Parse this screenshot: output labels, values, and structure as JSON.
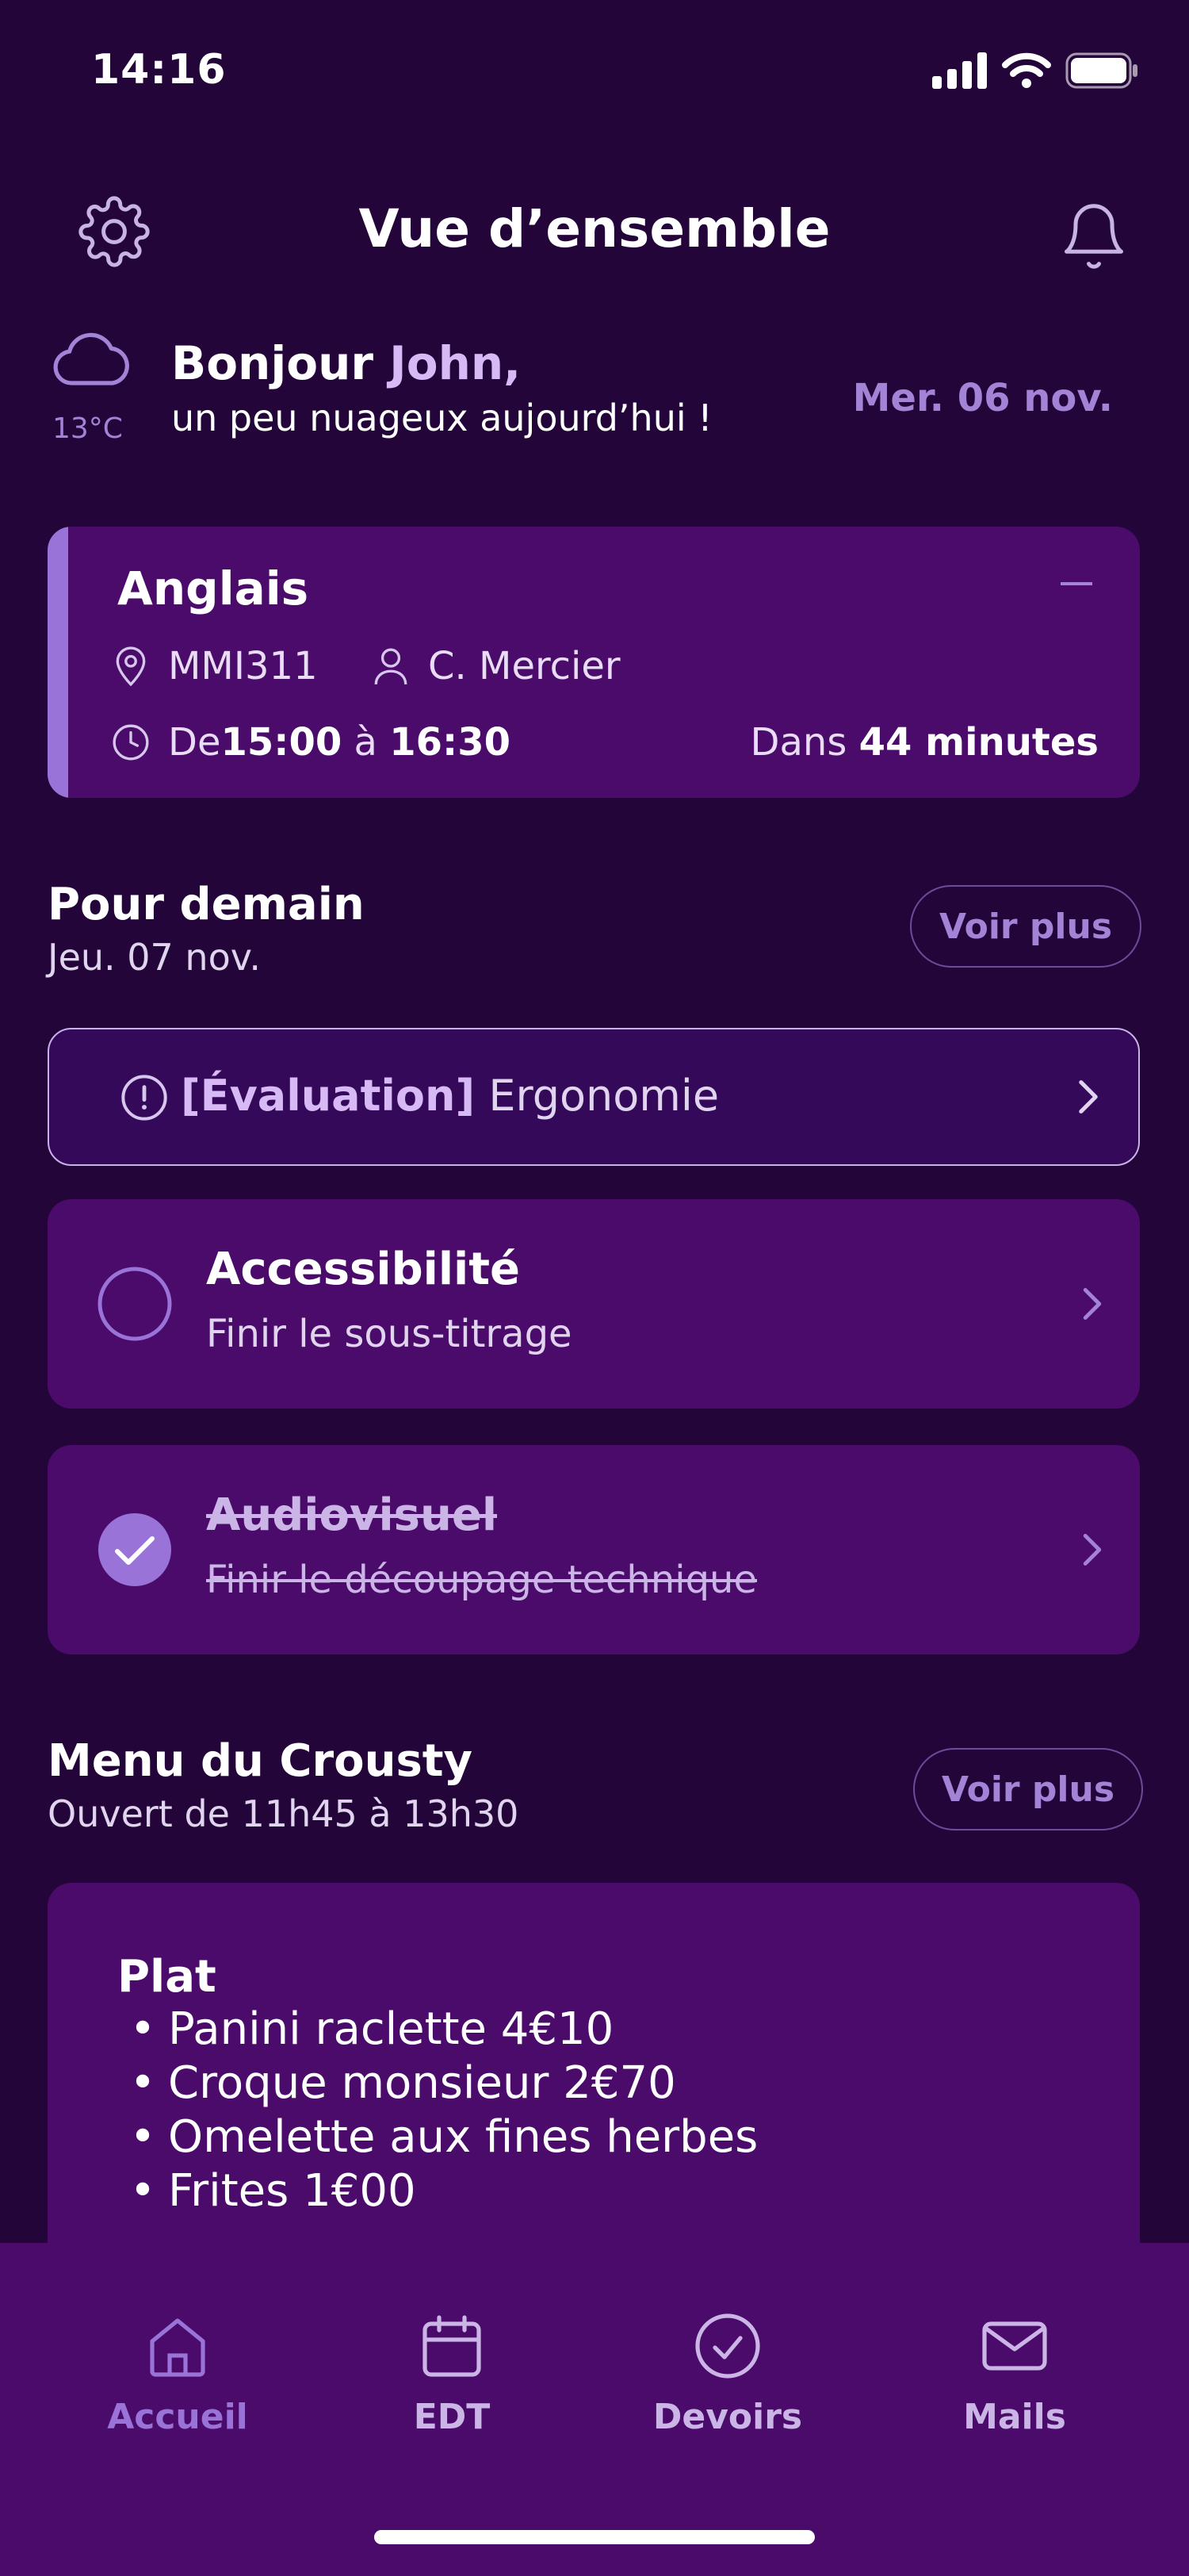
{
  "status_bar": {
    "time": "14:16"
  },
  "header": {
    "title": "Vue d’ensemble"
  },
  "greeting": {
    "weather_icon": "cloud-icon",
    "temperature": "13°C",
    "hello": "Bonjour ",
    "name": "John,",
    "subtitle": "un peu nuageux aujourd’hui !",
    "date": "Mer. 06 nov."
  },
  "current_class": {
    "title": "Anglais",
    "room": "MMI311",
    "teacher": "C. Mercier",
    "from_label": "De ",
    "start": "15:00",
    "to_label": " à ",
    "end": "16:30",
    "in_label": "Dans ",
    "countdown": "44 minutes"
  },
  "tomorrow": {
    "title": "Pour demain",
    "date": "Jeu. 07 nov.",
    "more_label": "Voir plus",
    "evaluation": {
      "tag": "[Évaluation]",
      "subject": " Ergonomie"
    },
    "tasks": [
      {
        "title": "Accessibilité",
        "detail": "Finir le sous-titrage",
        "done": false
      },
      {
        "title": "Audiovisuel",
        "detail": "Finir le découpage technique",
        "done": true
      }
    ]
  },
  "menu": {
    "title": "Menu du Crousty",
    "hours": "Ouvert de 11h45 à 13h30",
    "more_label": "Voir plus",
    "section": "Plat",
    "items": [
      "Panini raclette 4€10",
      "Croque monsieur 2€70",
      "Omelette aux fines herbes",
      "Frites 1€00"
    ]
  },
  "tabs": [
    {
      "label": "Accueil",
      "icon": "home-icon",
      "active": true
    },
    {
      "label": "EDT",
      "icon": "calendar-icon",
      "active": false
    },
    {
      "label": "Devoirs",
      "icon": "check-circle-icon",
      "active": false
    },
    {
      "label": "Mails",
      "icon": "mail-icon",
      "active": false
    }
  ],
  "colors": {
    "background": "#24053a",
    "card": "#4a0b6a",
    "accent": "#9a73d8",
    "highlight": "#d7b9f5"
  }
}
